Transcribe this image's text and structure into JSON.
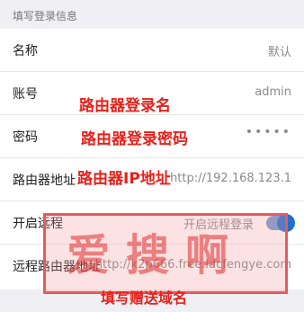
{
  "section_title": "填写登录信息",
  "rows": [
    {
      "label": "名称",
      "value": "默认"
    },
    {
      "label": "账号",
      "value": "admin"
    },
    {
      "label": "密码",
      "value": "•••••"
    },
    {
      "label": "路由器地址",
      "value": "http://192.168.123.1"
    },
    {
      "label": "开启远程",
      "value": "开启远程登录",
      "toggle_on": true
    },
    {
      "label": "远程路由器地址",
      "value": "http://k2p666.free.idcfengye.com"
    }
  ],
  "annotations": {
    "username": "路由器登录名",
    "password": "路由器登录密码",
    "address": "路由器IP地址",
    "remote": "填写赠送域名"
  },
  "watermark": "爱搜啊",
  "colors": {
    "annotation": "#e8201a",
    "toggle_on": "#1f6fd0",
    "watermark_border": "#e85a5a"
  }
}
